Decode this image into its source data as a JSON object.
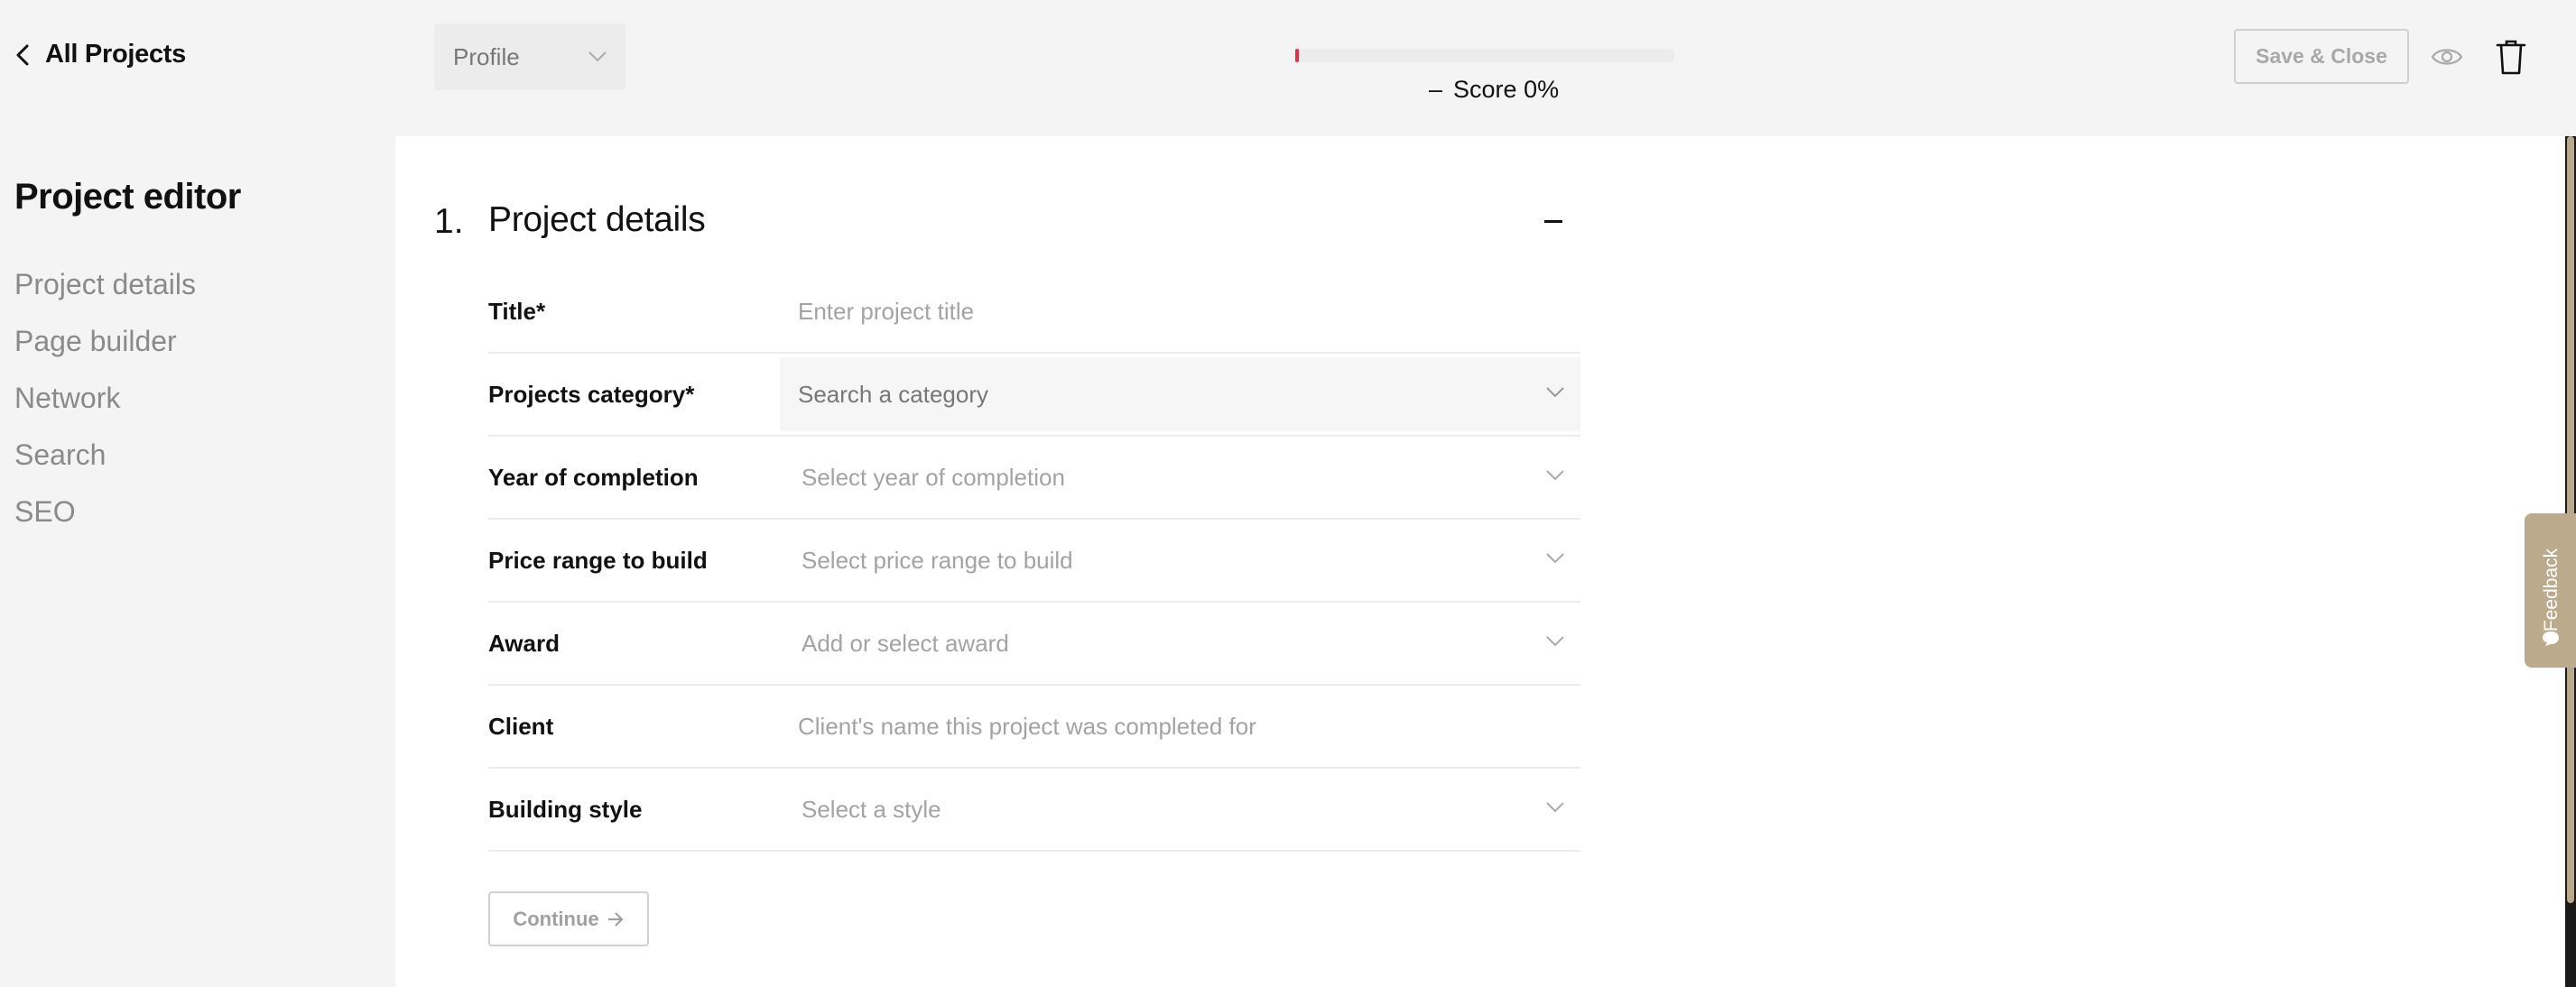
{
  "header": {
    "back_label": "All Projects",
    "profile_select": "Profile",
    "score": {
      "value": 0,
      "label": "Score 0%",
      "indicator": "–",
      "bar_color": "#e0334a"
    },
    "save_close_label": "Save & Close",
    "icons": {
      "back": "chevron-left-icon",
      "eye": "eye-icon",
      "trash": "trash-icon"
    }
  },
  "sidebar": {
    "title": "Project editor",
    "items": [
      {
        "label": "Project details"
      },
      {
        "label": "Page builder"
      },
      {
        "label": "Network"
      },
      {
        "label": "Search"
      },
      {
        "label": "SEO"
      }
    ]
  },
  "section": {
    "number": "1.",
    "title": "Project details",
    "fields": [
      {
        "label": "Title*",
        "placeholder": "Enter project title",
        "type": "text"
      },
      {
        "label": "Projects category*",
        "placeholder": "Search a category",
        "type": "search-select"
      },
      {
        "label": "Year of completion",
        "placeholder": "Select year of completion",
        "type": "select"
      },
      {
        "label": "Price range to build",
        "placeholder": "Select price range to build",
        "type": "select"
      },
      {
        "label": "Award",
        "placeholder": "Add or select award",
        "type": "select"
      },
      {
        "label": "Client",
        "placeholder": "Client's name this project was completed for",
        "type": "text"
      },
      {
        "label": "Building style",
        "placeholder": "Select a style",
        "type": "select"
      }
    ],
    "continue_label": "Continue"
  },
  "feedback": {
    "label": "Feedback",
    "icon": "chat-bubble-icon"
  },
  "colors": {
    "accent_red": "#e0334a",
    "feedback_tab": "#bbaa8c",
    "background": "#f4f4f4"
  }
}
